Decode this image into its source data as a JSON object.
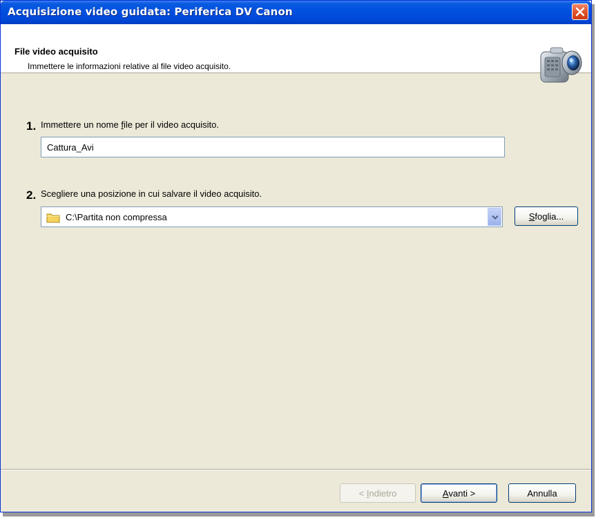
{
  "window": {
    "title": "Acquisizione video guidata: Periferica DV Canon"
  },
  "header": {
    "title": "File video acquisito",
    "subtitle": "Immettere le informazioni relative al file video acquisito."
  },
  "step1": {
    "number": "1.",
    "label_before": "Immettere un nome ",
    "label_hotkey": "f",
    "label_after": "ile per il video acquisito.",
    "filename_value": "Cattura_Avi"
  },
  "step2": {
    "number": "2.",
    "label_before": "Sce",
    "label_hotkey": "g",
    "label_after": "liere una posizione in cui salvare il video acquisito.",
    "location_value": "C:\\Partita non compressa",
    "browse_hotkey": "S",
    "browse_rest": "foglia..."
  },
  "buttons": {
    "back_prefix": "< ",
    "back_hotkey": "I",
    "back_rest": "ndietro",
    "next_hotkey": "A",
    "next_rest": "vanti >",
    "cancel": "Annulla"
  },
  "icons": {
    "close": "close-icon",
    "camera": "camcorder-icon",
    "folder": "folder-icon",
    "dropdown": "chevron-down-icon"
  },
  "colors": {
    "titlebar": "#0050e0",
    "dialog_bg": "#ece9d8",
    "close_button": "#e0552c"
  }
}
